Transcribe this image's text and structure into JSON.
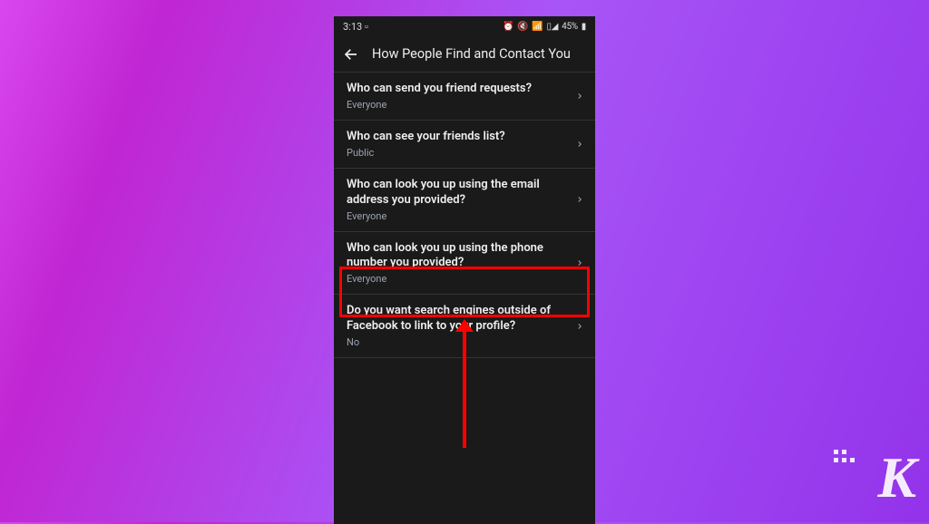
{
  "status_bar": {
    "time": "3:13",
    "battery": "45%"
  },
  "header": {
    "title": "How People Find and Contact You"
  },
  "settings": [
    {
      "title": "Who can send you friend requests?",
      "value": "Everyone"
    },
    {
      "title": "Who can see your friends list?",
      "value": "Public"
    },
    {
      "title": "Who can look you up using the email address you provided?",
      "value": "Everyone"
    },
    {
      "title": "Who can look you up using the phone number you provided?",
      "value": "Everyone"
    },
    {
      "title": "Do you want search engines outside of Facebook to link to your profile?",
      "value": "No"
    }
  ],
  "watermark": "K"
}
